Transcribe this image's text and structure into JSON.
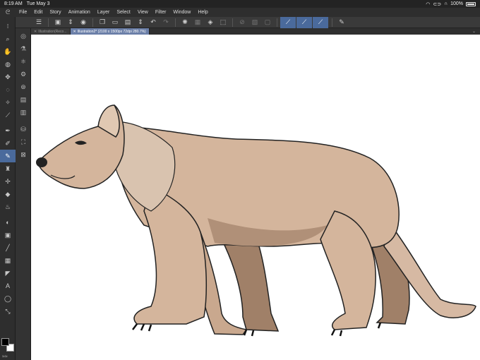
{
  "status": {
    "time": "8:19 AM",
    "date": "Tue May 3",
    "battery": "100%"
  },
  "menu": [
    "File",
    "Edit",
    "Story",
    "Animation",
    "Layer",
    "Select",
    "View",
    "Filter",
    "Window",
    "Help"
  ],
  "tabs": [
    {
      "label": "Illustration(Reco...",
      "active": false
    },
    {
      "label": "Illustration2* (2100 x 1500px 72dpi 280.7%)",
      "active": true
    }
  ],
  "colors": {
    "accent": "#4a6a9c",
    "fg": "#000000",
    "bg": "#ffffff"
  },
  "toolbar_icons": [
    "zoom-icon",
    "hand-icon",
    "rotate-icon",
    "move-icon",
    "lasso-icon",
    "magic-wand-icon",
    "eyedropper-icon",
    "pen-icon",
    "pencil-icon",
    "brush-icon",
    "airbrush-icon",
    "decoration-icon",
    "eraser-icon",
    "blend-icon",
    "fill-icon",
    "gradient-icon",
    "figure-icon",
    "frame-icon",
    "ruler-icon",
    "text-icon",
    "balloon-icon",
    "correct-line-icon"
  ],
  "subtool_icons": [
    "subtool-1-icon",
    "subtool-2-icon",
    "subtool-3-icon",
    "subtool-4-icon",
    "subtool-5-icon",
    "subtool-6-icon",
    "subtool-7-icon",
    "subtool-8-icon",
    "subtool-9-icon",
    "subtool-10-icon"
  ]
}
